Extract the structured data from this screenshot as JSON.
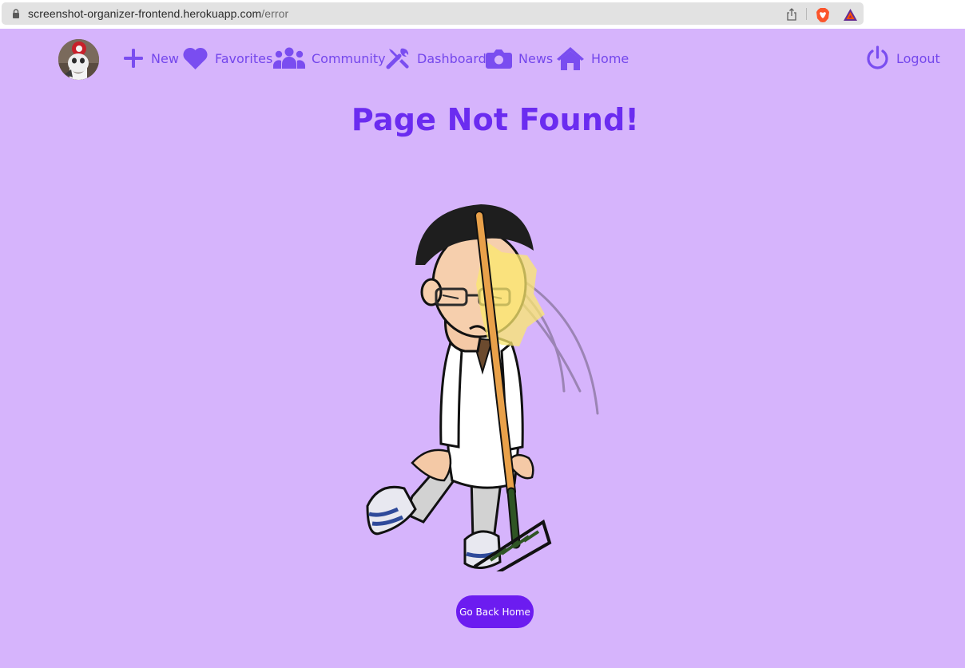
{
  "browser": {
    "url_host": "screenshot-organizer-frontend.herokuapp.com",
    "url_path": "/error",
    "icons": [
      "lock-icon",
      "share-icon",
      "brave-shields-icon",
      "brave-rewards-icon"
    ]
  },
  "nav": {
    "new_label": "New",
    "favorites_label": "Favorites",
    "community_label": "Community",
    "dashboard_label": "Dashboard",
    "news_label": "News",
    "home_label": "Home",
    "logout_label": "Logout",
    "icons": [
      "plus-icon",
      "heart-icon",
      "users-icon",
      "tools-icon",
      "camera-icon",
      "home-icon",
      "power-icon"
    ]
  },
  "main": {
    "title": "Page Not Found!",
    "button_label": "Go Back Home"
  },
  "colors": {
    "background": "#d6b4fc",
    "accent": "#7a4df0",
    "title": "#6b2cf0",
    "button": "#6c1cf0"
  }
}
